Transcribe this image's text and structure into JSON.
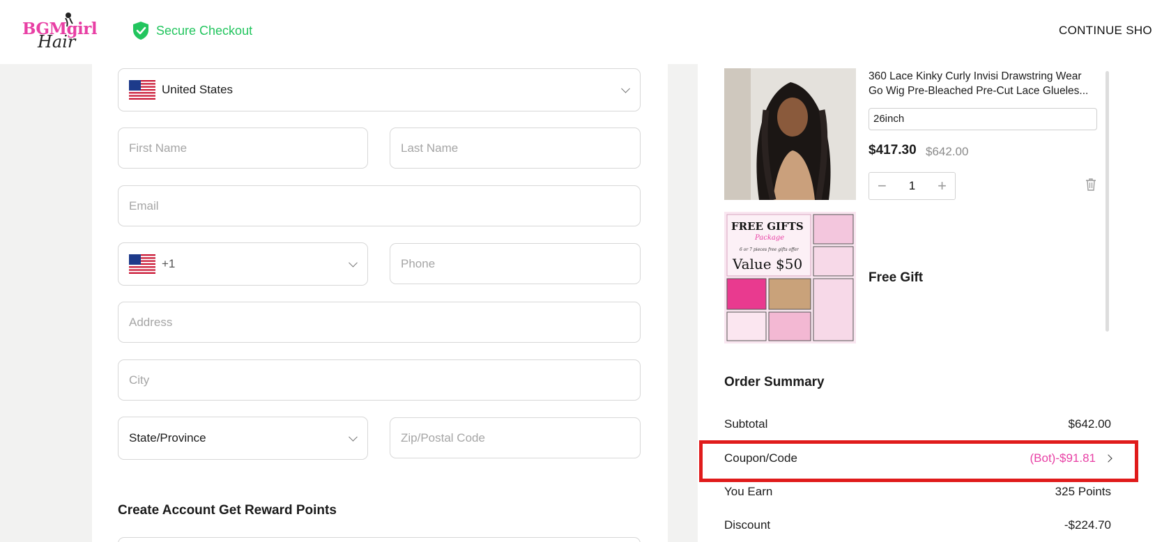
{
  "header": {
    "logo_text_top": "BGMgirl",
    "logo_text_bottom": "Hair",
    "secure_label": "Secure Checkout",
    "continue_label": "CONTINUE SHO"
  },
  "form": {
    "country": "United States",
    "first_name_placeholder": "First Name",
    "last_name_placeholder": "Last Name",
    "email_placeholder": "Email",
    "phone_code": "+1",
    "phone_placeholder": "Phone",
    "address_placeholder": "Address",
    "city_placeholder": "City",
    "state_placeholder": "State/Province",
    "zip_placeholder": "Zip/Postal Code",
    "account_title": "Create Account Get Reward Points"
  },
  "cart": {
    "product_title": "360 Lace Kinky Curly Invisi Drawstring Wear Go Wig Pre-Bleached Pre-Cut Lace Glueles...",
    "variant": "26inch",
    "price": "$417.30",
    "original_price": "$642.00",
    "quantity": "1",
    "minus": "−",
    "plus": "+",
    "gift": {
      "label": "Free Gift",
      "title": "FREE GIFTS",
      "subtitle": "Package",
      "note": "6 or 7 pieces free gifts offer",
      "value": "Value $50"
    }
  },
  "summary": {
    "title": "Order Summary",
    "subtotal_label": "Subtotal",
    "subtotal_value": "$642.00",
    "coupon_label": "Coupon/Code",
    "coupon_value": "(Bot)-$91.81",
    "earn_label": "You Earn",
    "earn_value": "325 Points",
    "discount_label": "Discount",
    "discount_value": "-$224.70"
  },
  "colors": {
    "brand_pink": "#e83fa4",
    "secure_green": "#22c55e",
    "highlight_red": "#e01b1b"
  }
}
